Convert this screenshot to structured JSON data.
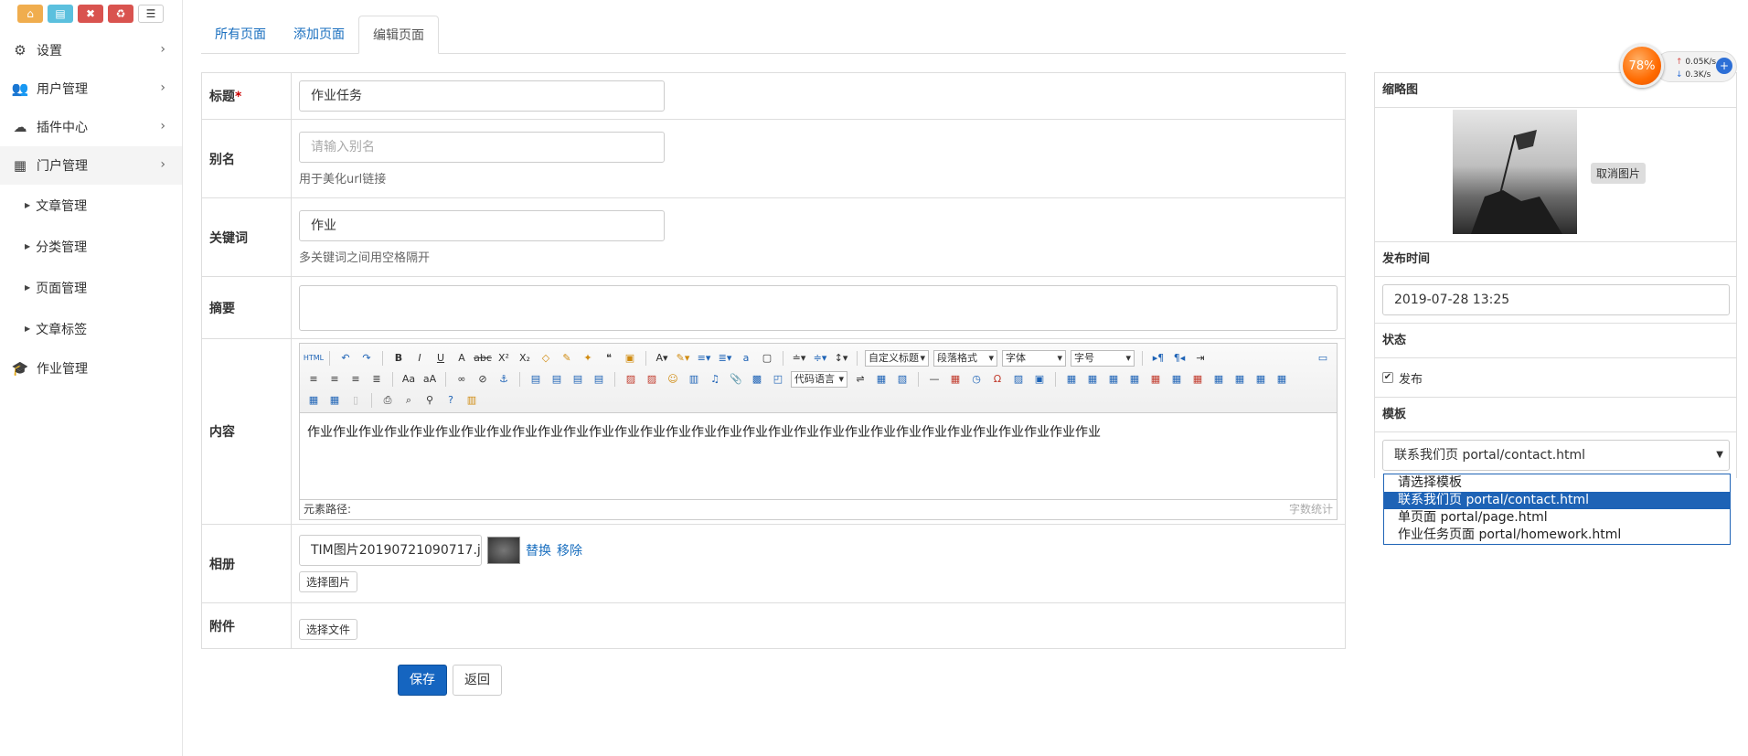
{
  "quick_buttons": [
    {
      "icon": "home-icon",
      "glyph": "⌂",
      "color": "#f0ad4e"
    },
    {
      "icon": "file-icon",
      "glyph": "▤",
      "color": "#5bc0de"
    },
    {
      "icon": "trash-icon",
      "glyph": "🗑",
      "color": "#d9534f"
    },
    {
      "icon": "recycle-icon",
      "glyph": "♻",
      "color": "#d9534f"
    },
    {
      "icon": "list-icon",
      "glyph": "☰",
      "color": "#ffffff"
    }
  ],
  "sidebar": {
    "items": [
      {
        "label": "设置",
        "icon": "gears-icon",
        "glyph": "⚙"
      },
      {
        "label": "用户管理",
        "icon": "users-icon",
        "glyph": "👥"
      },
      {
        "label": "插件中心",
        "icon": "cloud-icon",
        "glyph": "☁"
      },
      {
        "label": "门户管理",
        "icon": "grid-icon",
        "glyph": "▦"
      }
    ],
    "sub_items": [
      "文章管理",
      "分类管理",
      "页面管理",
      "文章标签"
    ],
    "last_item": {
      "label": "作业管理",
      "icon": "graduation-cap-icon",
      "glyph": "🎓"
    }
  },
  "tabs": [
    "所有页面",
    "添加页面",
    "编辑页面"
  ],
  "form": {
    "title_label": "标题",
    "title_required": "*",
    "title_value": "作业任务",
    "alias_label": "别名",
    "alias_placeholder": "请输入别名",
    "alias_help": "用于美化url链接",
    "keywords_label": "关键词",
    "keywords_value": "作业",
    "keywords_help": "多关键词之间用空格隔开",
    "summary_label": "摘要",
    "content_label": "内容",
    "content_text": "作业作业作业作业作业作业作业作业作业作业作业作业作业作业作业作业作业作业作业作业作业作业作业作业作业作业作业作业作业作业作业",
    "editor_path": "元素路径:",
    "editor_count": "字数统计",
    "editor_selects": {
      "custom_title": "自定义标题",
      "paragraph": "段落格式",
      "font": "字体",
      "size": "字号",
      "code_lang": "代码语言"
    },
    "album_label": "相册",
    "album_file": "TIM图片20190721090717.j",
    "album_replace": "替换",
    "album_remove": "移除",
    "album_choose": "选择图片",
    "attach_label": "附件",
    "attach_choose": "选择文件"
  },
  "buttons": {
    "save": "保存",
    "back": "返回"
  },
  "side": {
    "thumb_title": "缩略图",
    "thumb_cancel": "取消图片",
    "pubtime_title": "发布时间",
    "pubtime_value": "2019-07-28 13:25",
    "status_title": "状态",
    "status_publish": "发布",
    "template_title": "模板",
    "template_selected": "联系我们页 portal/contact.html",
    "template_options": [
      "请选择模板",
      "联系我们页 portal/contact.html",
      "单页面 portal/page.html",
      "作业任务页面 portal/homework.html"
    ],
    "template_highlight_index": 1
  },
  "net_widget": {
    "percent": "78%",
    "up": "0.05K/s",
    "down": "0.3K/s"
  }
}
